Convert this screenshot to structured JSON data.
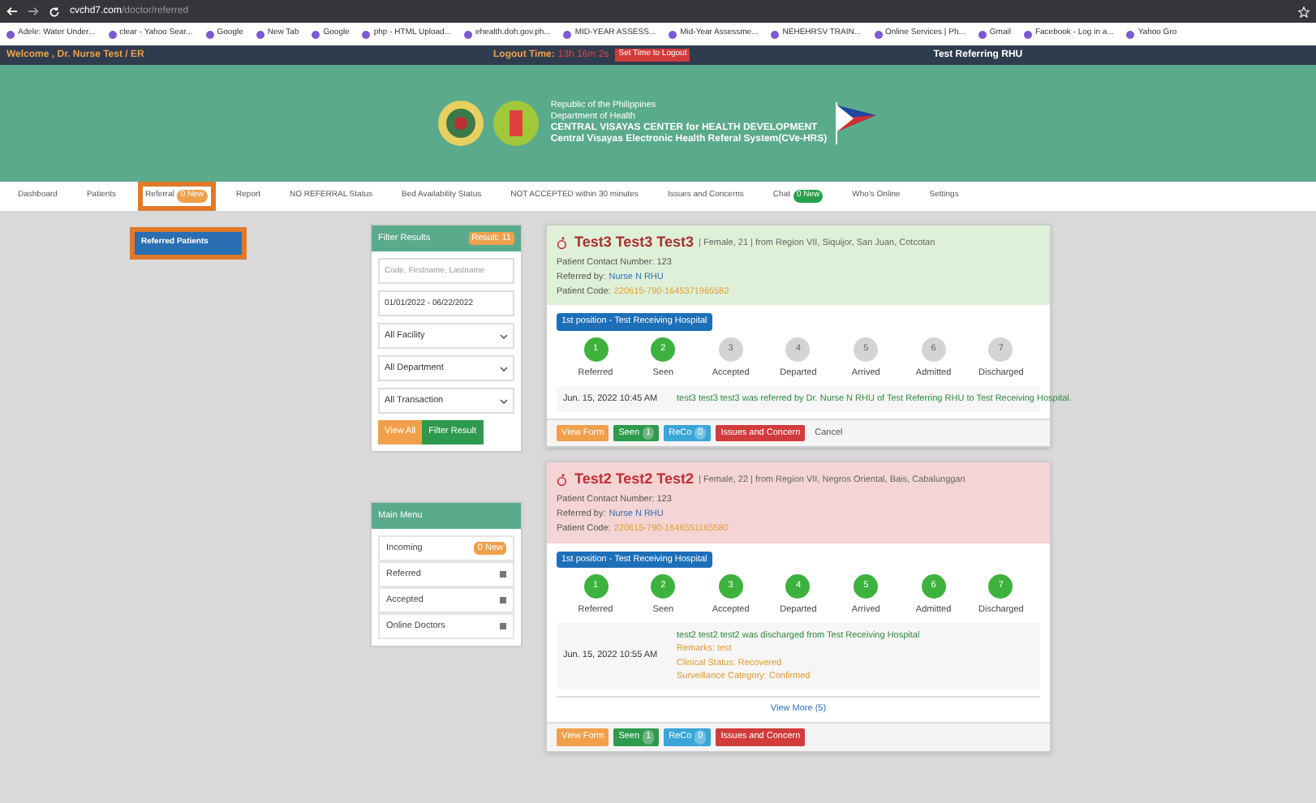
{
  "browser": {
    "url_host": "cvchd7.com",
    "url_path": "/doctor/referred",
    "bookmarks": [
      "Adele: Water Under...",
      "clear - Yahoo Sear...",
      "Google",
      "New Tab",
      "Google",
      "php - HTML Upload...",
      "ehealth.doh.gov.ph...",
      "MID-YEAR ASSESS...",
      "Mid-Year Assessme...",
      "NEHEHRSV TRAIN...",
      "Online Services | Ph...",
      "Gmail",
      "Facebook - Log in a...",
      "Yahoo Gro"
    ]
  },
  "topbar": {
    "welcome": "Welcome , Dr. Nurse Test / ER",
    "logout_label": "Logout Time:",
    "logout_time": "13h 16m 2s",
    "logout_button": "Set Time to Logout",
    "facility": "Test Referring RHU"
  },
  "header": {
    "lines": [
      "Republic of the Philippines",
      "Department of Health",
      "CENTRAL VISAYAS CENTER for HEALTH DEVELOPMENT",
      "Central Visayas Electronic Health Referal System(CVe-HRS)"
    ]
  },
  "nav": [
    {
      "label": "Dashboard",
      "highlighted": false
    },
    {
      "label": "Patients",
      "highlighted": false
    },
    {
      "label": "Referral",
      "badge": "0 New",
      "color": "#f0a04b",
      "highlighted": true
    },
    {
      "label": "Report",
      "highlighted": false
    },
    {
      "label": "NO REFERRAL Status",
      "highlighted": false
    },
    {
      "label": "Bed Availability Status",
      "highlighted": false
    },
    {
      "label": "NOT ACCEPTED within 30 minutes",
      "highlighted": false
    },
    {
      "label": "Issues and Concerns",
      "highlighted": false
    },
    {
      "label": "Chat",
      "badge": "0 New",
      "color": "#22a04b",
      "highlighted": false
    },
    {
      "label": "Who's Online",
      "highlighted": false
    },
    {
      "label": "Settings",
      "highlighted": false
    }
  ],
  "dropdown": {
    "label": "Referred Patients",
    "highlighted": true
  },
  "filter": {
    "title": "Filter Results",
    "badge": "Result: 11",
    "search_placeholder": "Code, Firstname, Lastname",
    "date_range": "01/01/2022 - 06/22/2022",
    "selects": [
      "All Facility",
      "All Department",
      "All Transaction"
    ],
    "buttons": [
      {
        "label": "View All",
        "kind": "warning"
      },
      {
        "label": "Filter Result",
        "kind": "success"
      }
    ]
  },
  "main_menu": {
    "title": "Main Menu",
    "items": [
      {
        "label": "Incoming",
        "badge": "0 New"
      },
      {
        "label": "Referred"
      },
      {
        "label": "Accepted"
      },
      {
        "label": "Online Doctors"
      }
    ]
  },
  "cards": [
    {
      "kind": "green",
      "name": "Test3 Test3 Test3",
      "meta": "| Female, 21 | from Region VII, Siquijor, San Juan, Cotcotan",
      "contact": "Patient Contact Number: 123",
      "referred_by_label": "Referred by:",
      "referred_by": "Nurse N RHU",
      "code_label": "Patient Code:",
      "code": "220615-790-1645371965582",
      "position": "1st position - Test Receiving Hospital",
      "steps": [
        {
          "num": "1",
          "label": "Referred",
          "done": true
        },
        {
          "num": "2",
          "label": "Seen",
          "done": true
        },
        {
          "num": "3",
          "label": "Accepted",
          "done": false
        },
        {
          "num": "4",
          "label": "Departed",
          "done": false
        },
        {
          "num": "5",
          "label": "Arrived",
          "done": false
        },
        {
          "num": "6",
          "label": "Admitted",
          "done": false
        },
        {
          "num": "7",
          "label": "Discharged",
          "done": false
        }
      ],
      "log_date": "Jun. 15, 2022 10:45 AM",
      "log_lines": [
        "test3 test3 test3 was referred by Dr. Nurse N RHU of Test Referring RHU to Test Receiving Hospital."
      ],
      "buttons": [
        {
          "label": "View Form",
          "kind": "warning"
        },
        {
          "label": "Seen",
          "kind": "success",
          "count": "1"
        },
        {
          "label": "ReCo",
          "kind": "info",
          "count": "0"
        },
        {
          "label": "Issues and Concern",
          "kind": "danger"
        },
        {
          "label": "Cancel",
          "kind": "plain"
        }
      ]
    },
    {
      "kind": "red",
      "name": "Test2 Test2 Test2",
      "meta": "| Female, 22 | from Region VII, Negros Oriental, Bais, Cabalunggan",
      "contact": "Patient Contact Number: 123",
      "referred_by_label": "Referred by:",
      "referred_by": "Nurse N RHU",
      "code_label": "Patient Code:",
      "code": "220615-790-1646551165580",
      "position": "1st position - Test Receiving Hospital",
      "steps": [
        {
          "num": "1",
          "label": "Referred",
          "done": true
        },
        {
          "num": "2",
          "label": "Seen",
          "done": true
        },
        {
          "num": "3",
          "label": "Accepted",
          "done": true
        },
        {
          "num": "4",
          "label": "Departed",
          "done": true
        },
        {
          "num": "5",
          "label": "Arrived",
          "done": true
        },
        {
          "num": "6",
          "label": "Admitted",
          "done": true
        },
        {
          "num": "7",
          "label": "Discharged",
          "done": true
        }
      ],
      "log_date": "Jun. 15, 2022 10:55 AM",
      "log_lines": [
        "test2 test2 test2 was discharged from Test Receiving Hospital",
        "Remarks: test",
        "Clinical Status: Recovered",
        "Surveillance Category: Confirmed"
      ],
      "view_more": "View More (5)",
      "buttons": [
        {
          "label": "View Form",
          "kind": "warning"
        },
        {
          "label": "Seen",
          "kind": "success",
          "count": "1"
        },
        {
          "label": "ReCo",
          "kind": "info",
          "count": "0"
        },
        {
          "label": "Issues and Concern",
          "kind": "danger"
        }
      ]
    }
  ]
}
